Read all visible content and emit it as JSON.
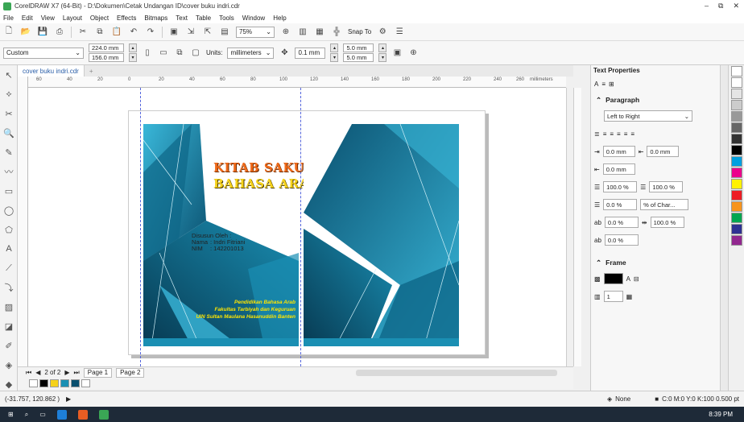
{
  "window": {
    "title": "CorelDRAW X7 (64-Bit) - D:\\Dokumen\\Cetak Undangan ID\\cover buku indri.cdr",
    "controls": [
      "–",
      "⧉",
      "✕"
    ]
  },
  "menu": [
    "File",
    "Edit",
    "View",
    "Layout",
    "Object",
    "Effects",
    "Bitmaps",
    "Text",
    "Table",
    "Tools",
    "Window",
    "Help"
  ],
  "toolbar": {
    "zoom": "75%",
    "snap_label": "Snap To"
  },
  "propertybar": {
    "preset": "Custom",
    "width": "224.0 mm",
    "height": "156.0 mm",
    "units_label": "Units:",
    "units_value": "millimeters",
    "nudge": "0.1 mm",
    "dup_x": "5.0 mm",
    "dup_y": "5.0 mm"
  },
  "document": {
    "tab": "cover buku indri.cdr",
    "ruler_ticks": [
      "60",
      "40",
      "20",
      "0",
      "20",
      "40",
      "60",
      "80",
      "100",
      "120",
      "140",
      "160",
      "180",
      "200",
      "220",
      "240",
      "260"
    ],
    "ruler_unit": "millimeters"
  },
  "cover_left": {
    "title1": "KITAB SAKU",
    "title2": "BAHASA ARAB",
    "byline": "Disusun Oleh :",
    "name_label": "Nama",
    "name_value": ": Indri Fitriani",
    "nim_label": "NIM",
    "nim_value": ": 142201013",
    "footer1": "Pendidikan Bahasa Arab",
    "footer2": "Fakultas Tarbiyah dan Keguruan",
    "footer3": "UIN Sultan Maulana Hasanuddin Banten"
  },
  "pages": {
    "counter": "2 of 2",
    "tabs": [
      "Page 1",
      "Page 2"
    ]
  },
  "status": {
    "coords": "(-31.757, 120.862 )",
    "fill_none": "None",
    "outline": "C:0 M:0 Y:0 K:100  0.500 pt"
  },
  "panel": {
    "title": "Text Properties",
    "paragraph_head": "Paragraph",
    "direction": "Left to Right",
    "indent_left": "0.0 mm",
    "indent_right": "0.0 mm",
    "indent_first": "0.0 mm",
    "line_spacing": "100.0 %",
    "char_spacing": "100.0 %",
    "before_para": "0.0 %",
    "spacing_unit": "% of Char...",
    "word_spacing": "100.0 %",
    "lang_spacing": "0.0 %",
    "lang_spacing2": "0.0 %",
    "frame_head": "Frame",
    "columns": "1"
  },
  "taskbar": {
    "time": "8:39 PM"
  },
  "colors": {
    "teal_dark": "#0a4f6e",
    "teal_mid": "#1a8fb3",
    "teal_light": "#39b7d9",
    "title_orange": "#f06a1a",
    "title_yellow": "#f6d21a",
    "footer_yellow": "#ffe600"
  }
}
